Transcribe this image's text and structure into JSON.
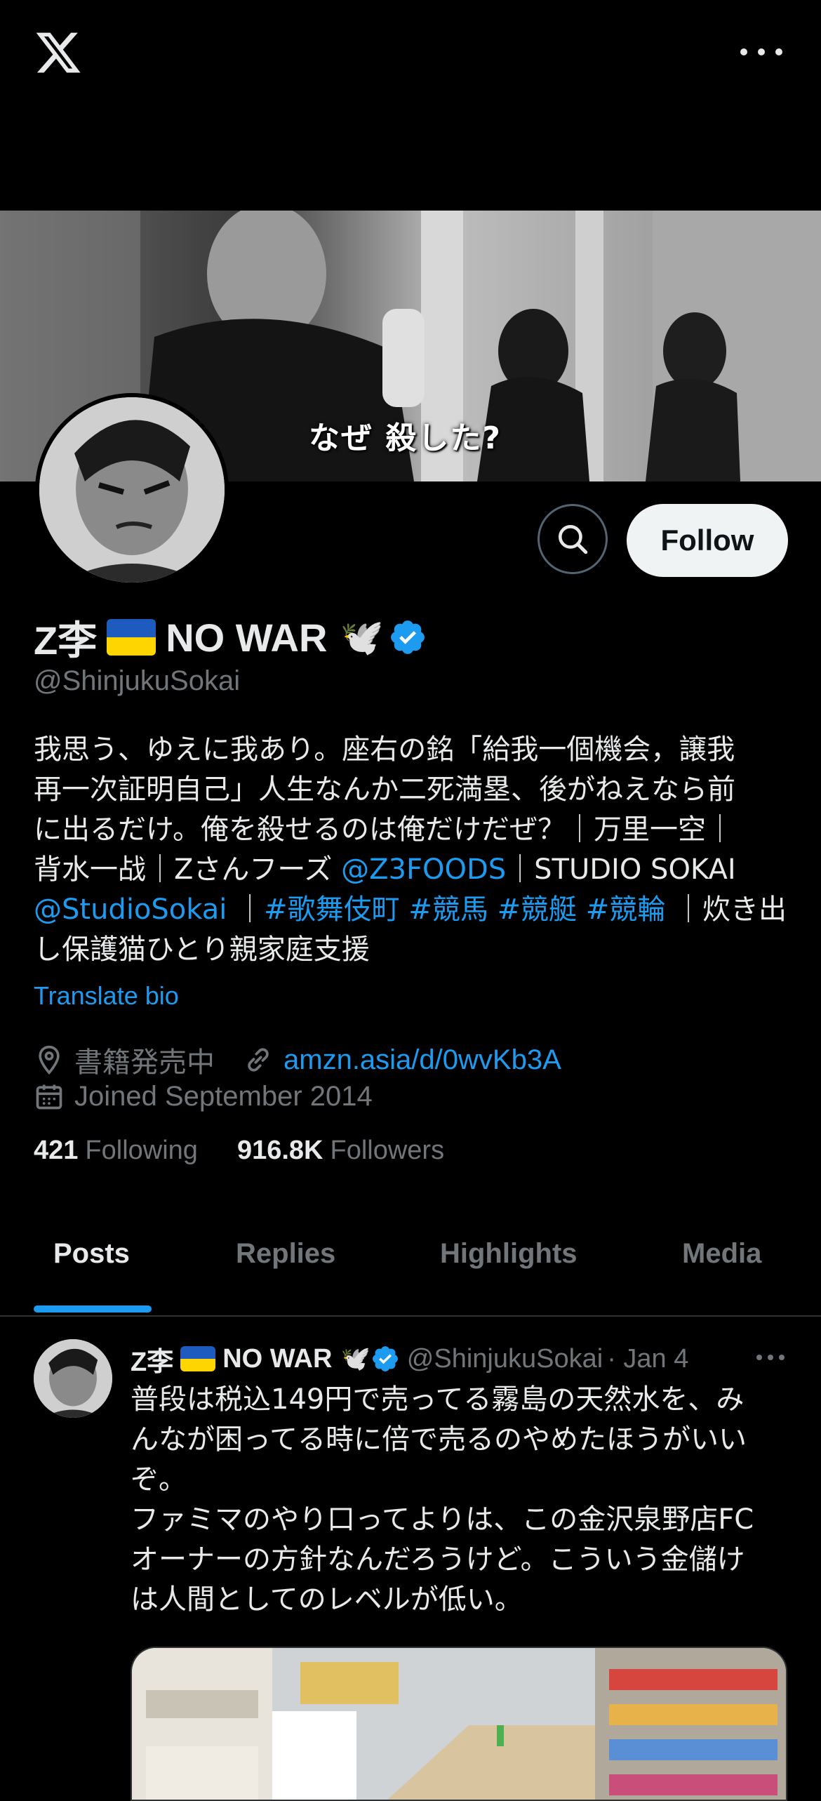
{
  "header": {
    "logo_icon": "x-logo-icon",
    "more_icon": "more-horizontal-icon"
  },
  "banner": {
    "caption": "なぜ 殺した?"
  },
  "profile": {
    "name": "Z李",
    "name_suffix": "NO WAR",
    "emoji": "🕊️",
    "verified": true,
    "handle": "@ShinjukuSokai",
    "follow_label": "Follow",
    "bio_lines": [
      "我思う、ゆえに我あり。座右の銘「給我一個機会，譲我",
      "再一次証明自己」人生なんか二死満塁、後がねえなら前",
      "に出るだけ。俺を殺せるのは俺だけだぜ？｜万里一空｜"
    ],
    "bio_line4_pre": "背水一战｜Zさんフーズ ",
    "bio_line4_link": "@Z3FOODS",
    "bio_line4_post": "｜STUDIO SOKAI",
    "bio_line5_link1": "@StudioSokai",
    "bio_line5_sep": " ｜",
    "bio_line5_tags": "#歌舞伎町 #競馬 #競艇 #競輪",
    "bio_line5_post": " ｜炊き出",
    "bio_line6": "し保護猫ひとり親家庭支援",
    "translate_label": "Translate bio",
    "location": "書籍発売中",
    "website": "amzn.asia/d/0wvKb3A",
    "joined": "Joined September 2014",
    "following_count": "421",
    "following_label": "Following",
    "followers_count": "916.8K",
    "followers_label": "Followers"
  },
  "tabs": [
    {
      "label": "Posts",
      "active": true
    },
    {
      "label": "Replies",
      "active": false
    },
    {
      "label": "Highlights",
      "active": false
    },
    {
      "label": "Media",
      "active": false
    }
  ],
  "post": {
    "name": "Z李",
    "name_suffix": "NO WAR",
    "handle": "@ShinjukuSokai",
    "date": "· Jan 4",
    "text_lines": [
      "普段は税込149円で売ってる霧島の天然水を、み",
      "んなが困ってる時に倍で売るのやめたほうがいい",
      "ぞ。",
      "ファミマのやり口ってよりは、この金沢泉野店FC",
      "オーナーの方針なんだろうけど。こういう金儲け",
      "は人間としてのレベルが低い。"
    ]
  },
  "colors": {
    "accent": "#1d9bf0",
    "background": "#000000",
    "muted": "#71767b",
    "text": "#e7e9ea"
  }
}
